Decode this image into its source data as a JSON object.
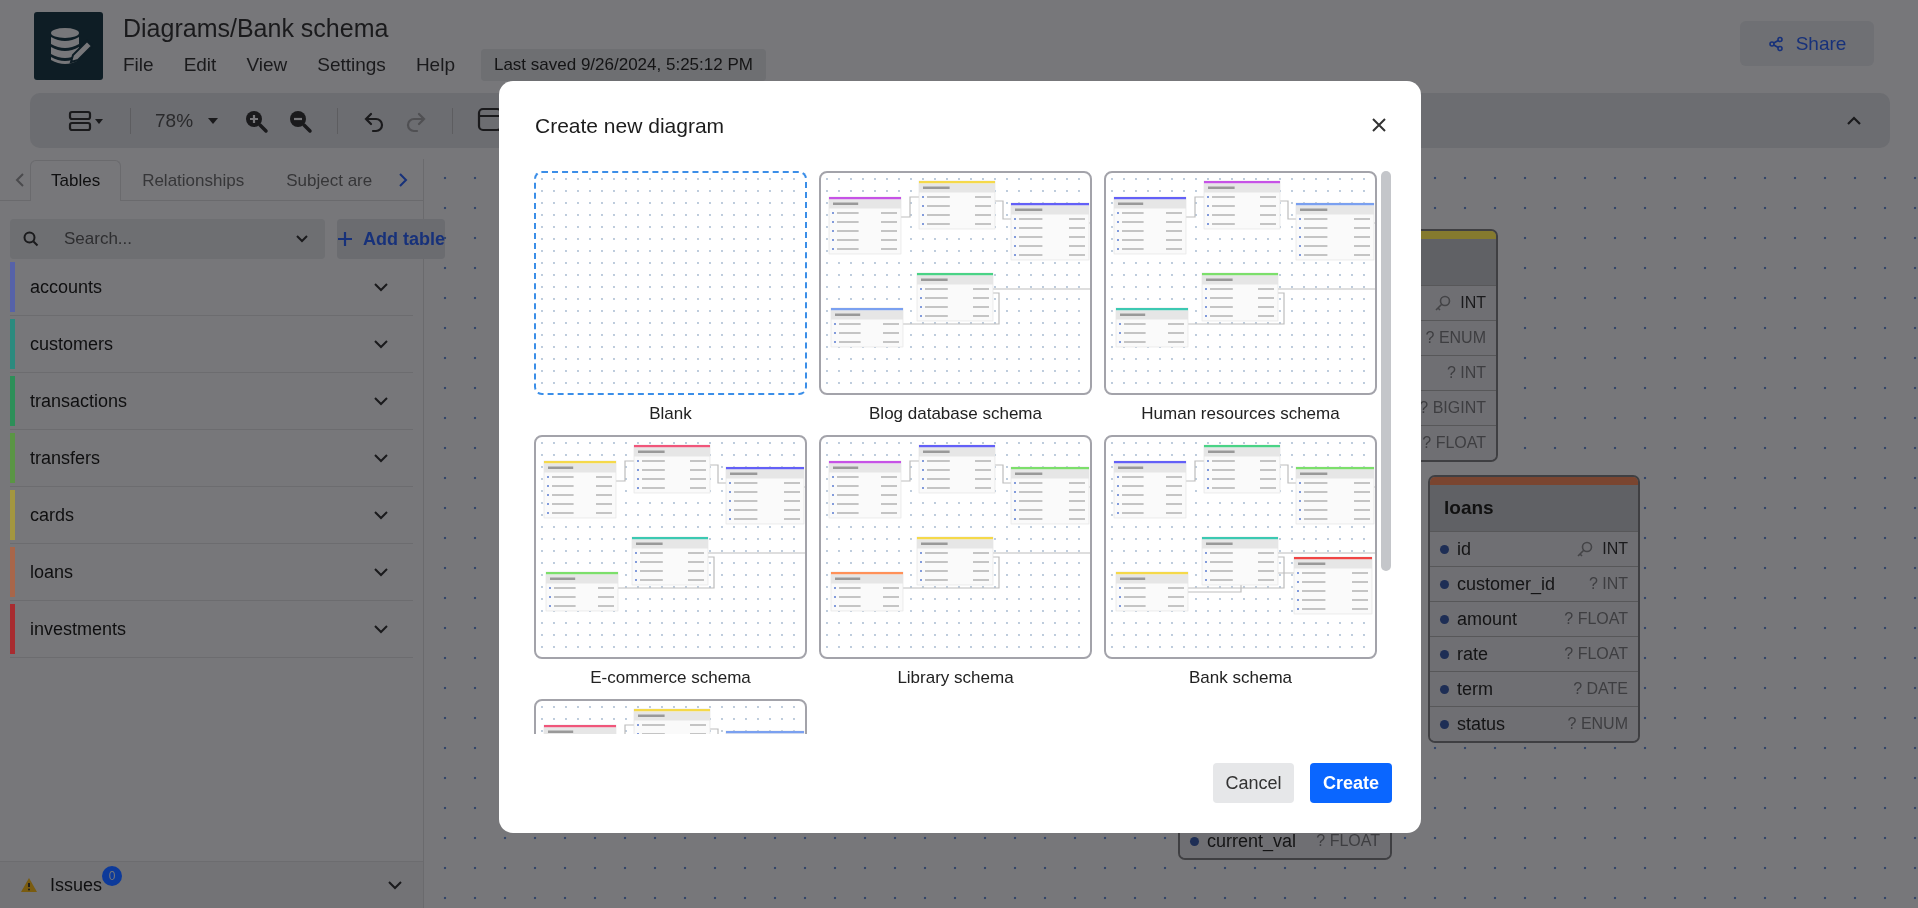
{
  "app": {
    "title": "Diagrams/Bank schema",
    "menu": [
      "File",
      "Edit",
      "View",
      "Settings",
      "Help"
    ],
    "last_saved": "Last saved 9/26/2024, 5:25:12 PM",
    "share": "Share"
  },
  "toolbar": {
    "zoom": "78%"
  },
  "sidebar": {
    "tabs": [
      {
        "label": "Tables",
        "selected": true
      },
      {
        "label": "Relationships",
        "selected": false
      },
      {
        "label": "Subject are",
        "selected": false
      }
    ],
    "search": {
      "placeholder": "Search..."
    },
    "add_table": "Add table",
    "tables": [
      {
        "name": "accounts",
        "color": "#5662a8"
      },
      {
        "name": "customers",
        "color": "#2c8a7e"
      },
      {
        "name": "transactions",
        "color": "#2d8f58"
      },
      {
        "name": "transfers",
        "color": "#5a9544"
      },
      {
        "name": "cards",
        "color": "#a39640"
      },
      {
        "name": "loans",
        "color": "#a8664a"
      },
      {
        "name": "investments",
        "color": "#a82c30"
      }
    ],
    "issues": {
      "label": "Issues",
      "count": "0"
    }
  },
  "canvas": {
    "tables": [
      {
        "color": "#857a2e",
        "fields": [
          {
            "type": "INT",
            "primary": true
          },
          {
            "type": "? ENUM",
            "primary": false
          },
          {
            "type": "? INT",
            "primary": false
          },
          {
            "type": "? BIGINT",
            "primary": false
          },
          {
            "type": "? FLOAT",
            "primary": false
          }
        ]
      },
      {
        "name": "loans",
        "color": "#7a4530",
        "fields": [
          {
            "name": "id",
            "type": "INT",
            "primary": true
          },
          {
            "name": "customer_id",
            "type": "? INT",
            "primary": false
          },
          {
            "name": "amount",
            "type": "? FLOAT",
            "primary": false
          },
          {
            "name": "rate",
            "type": "? FLOAT",
            "primary": false
          },
          {
            "name": "term",
            "type": "? DATE",
            "primary": false
          },
          {
            "name": "status",
            "type": "? ENUM",
            "primary": false
          }
        ]
      },
      {
        "fields": [
          {
            "name": "current_val",
            "type": "? FLOAT",
            "primary": false
          }
        ]
      }
    ]
  },
  "dialog": {
    "title": "Create new diagram",
    "templates": [
      {
        "label": "Blank",
        "selected": true,
        "kind": "blank"
      },
      {
        "label": "Blog database schema",
        "selected": false,
        "kind": "schema",
        "tables": [
          {
            "color": "#c653e6"
          },
          {
            "color": "#f5d94a"
          },
          {
            "color": "#6360f7"
          },
          {
            "color": "#4ad386"
          },
          {
            "color": "#7aa0f0"
          }
        ]
      },
      {
        "label": "Human resources schema",
        "selected": false,
        "kind": "schema",
        "tables": [
          {
            "color": "#6360f7"
          },
          {
            "color": "#c653e6"
          },
          {
            "color": "#7aa0f0"
          },
          {
            "color": "#7cdf6b"
          },
          {
            "color": "#3cc9b2"
          }
        ]
      },
      {
        "label": "E-commerce schema",
        "selected": false,
        "kind": "schema",
        "tables": [
          {
            "color": "#f5d94a"
          },
          {
            "color": "#f0567a"
          },
          {
            "color": "#6360f7"
          },
          {
            "color": "#3cc9b2"
          },
          {
            "color": "#7cdf6b"
          }
        ]
      },
      {
        "label": "Library schema",
        "selected": false,
        "kind": "schema",
        "tables": [
          {
            "color": "#c653e6"
          },
          {
            "color": "#6360f7"
          },
          {
            "color": "#7cdf6b"
          },
          {
            "color": "#f5d94a"
          },
          {
            "color": "#ff9159"
          }
        ]
      },
      {
        "label": "Bank schema",
        "selected": false,
        "kind": "schema",
        "tables": [
          {
            "color": "#6360f7"
          },
          {
            "color": "#4ad386"
          },
          {
            "color": "#7cdf6b"
          },
          {
            "color": "#3cc9b2"
          },
          {
            "color": "#f5d94a"
          },
          {
            "color": "#f04545"
          }
        ]
      },
      {
        "selected": false,
        "kind": "schema",
        "tables": [
          {
            "color": "#f0567a"
          },
          {
            "color": "#f5d94a"
          },
          {
            "color": "#7aa0f0"
          }
        ]
      }
    ],
    "cancel": "Cancel",
    "create": "Create"
  }
}
